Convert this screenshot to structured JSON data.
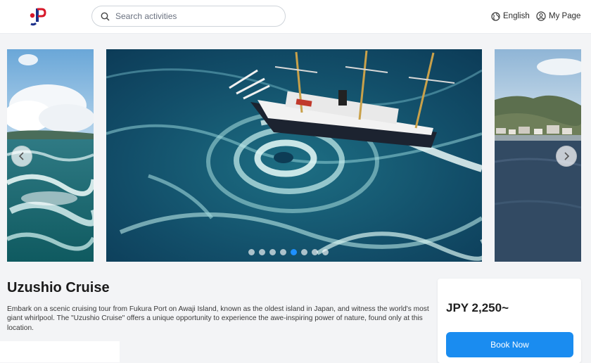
{
  "header": {
    "logo": "JP",
    "search_placeholder": "Search activities",
    "language_label": "English",
    "mypage_label": "My Page"
  },
  "carousel": {
    "slide_count": 8,
    "active_index": 4
  },
  "activity": {
    "title": "Uzushio Cruise",
    "description": "Embark on a scenic cruising tour from Fukura Port on Awaji Island, known as the oldest island in Japan, and witness the world's most giant whirlpool. The \"Uzushio Cruise\" offers a unique opportunity to experience the awe-inspiring power of nature, found only at this location.",
    "price": "JPY 2,250~",
    "book_label": "Book Now"
  },
  "icons": {
    "search": "search-icon",
    "globe": "globe-icon",
    "user": "user-icon",
    "prev": "chevron-left-icon",
    "next": "chevron-right-icon"
  },
  "colors": {
    "accent": "#1a8cf0",
    "logo_red": "#d7192a",
    "logo_blue": "#1a2f8a"
  }
}
